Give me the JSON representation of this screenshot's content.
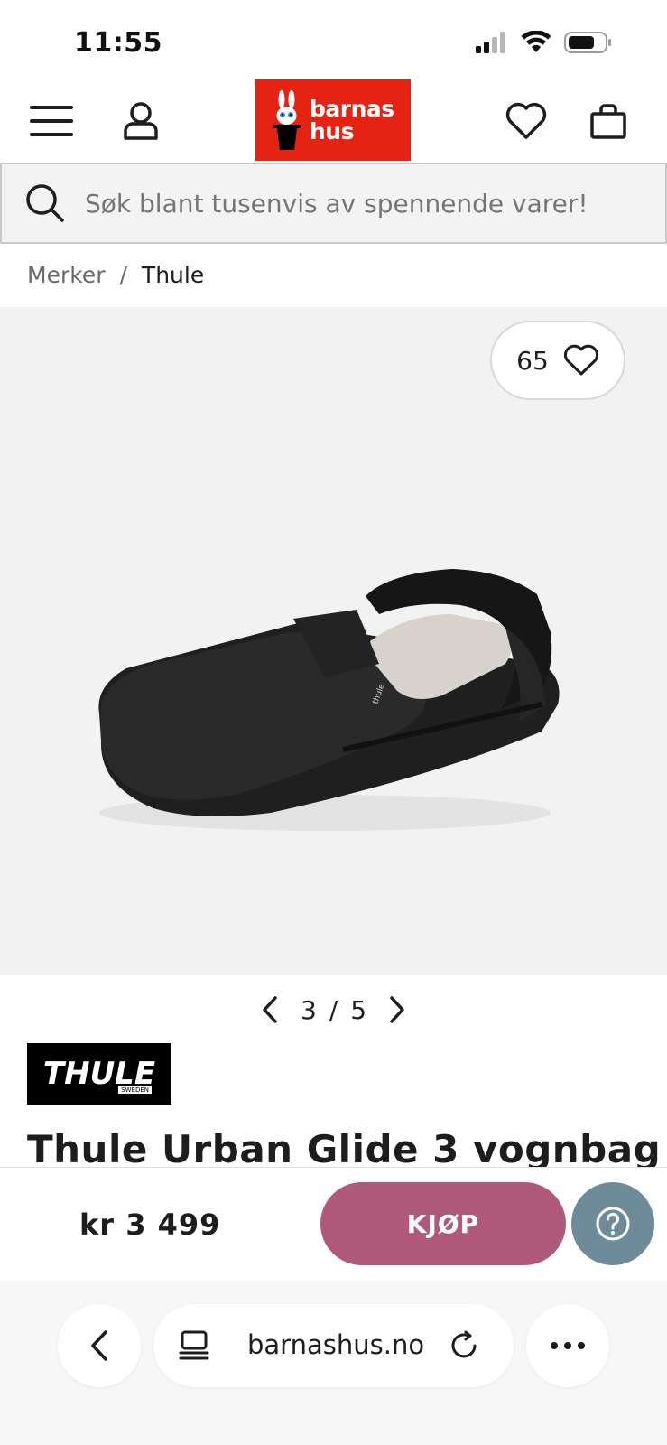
{
  "status_bar": {
    "time": "11:55"
  },
  "header": {
    "logo_text_line1": "barnas",
    "logo_text_line2": "hus",
    "menu_icon": "hamburger-menu-icon",
    "account_icon": "user-icon",
    "wishlist_icon": "heart-icon",
    "cart_icon": "shopping-bag-icon"
  },
  "search": {
    "placeholder": "Søk blant tusenvis av spennende varer!"
  },
  "breadcrumb": {
    "items": [
      "Merker",
      "Thule"
    ],
    "separator": "/"
  },
  "gallery": {
    "favorite_count": "65",
    "current_page": "3",
    "separator": "/",
    "total_pages": "5"
  },
  "product": {
    "brand_logo_text": "THULE",
    "brand_logo_subtext": "SWEDEN",
    "title": "Thule Urban Glide 3 vognbag",
    "price": "kr 3 499"
  },
  "actions": {
    "buy_label": "KJØP",
    "help_icon": "question-mark-icon"
  },
  "browser": {
    "url": "barnashus.no",
    "back_icon": "chevron-left-icon",
    "tabs_icon": "tabs-icon",
    "reload_icon": "reload-icon",
    "more_icon": "more-dots-icon"
  },
  "colors": {
    "brand_red": "#e42313",
    "buy_button": "#b1597a",
    "help_button": "#6e8b9a",
    "gallery_bg": "#f2f2f2"
  }
}
